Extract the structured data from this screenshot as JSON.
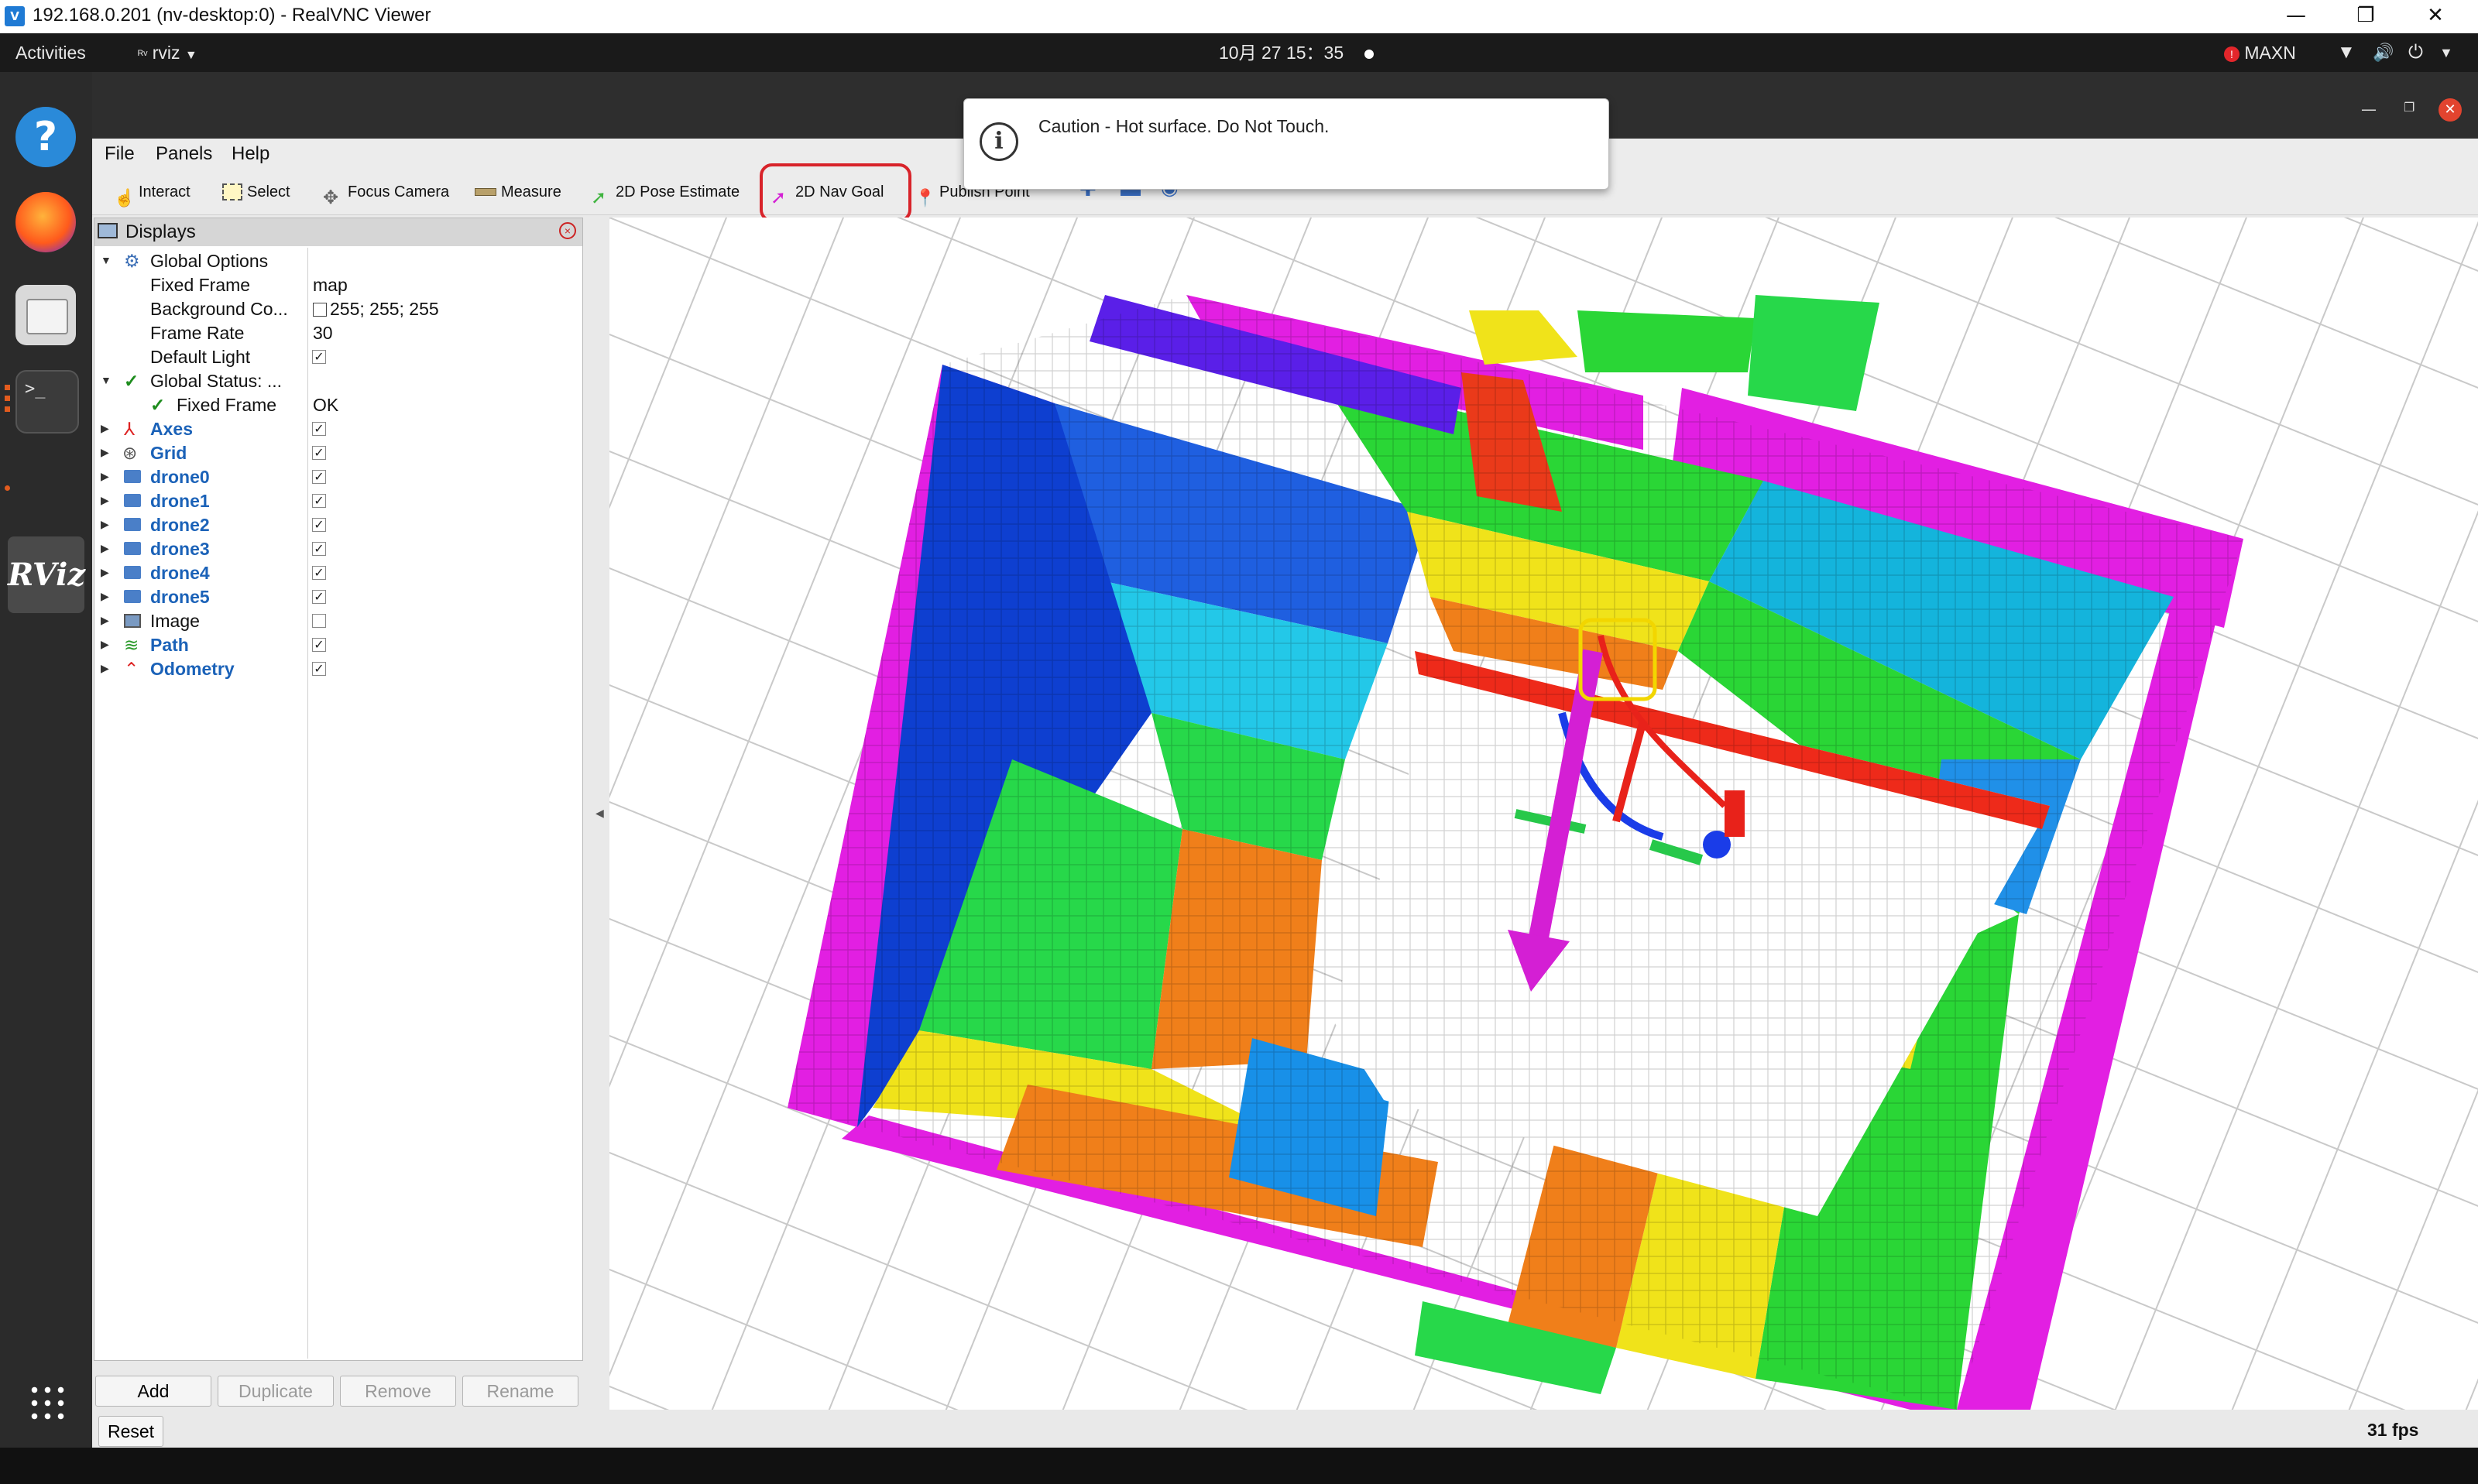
{
  "vnc": {
    "title": "192.168.0.201 (nv-desktop:0) - RealVNC Viewer",
    "minimize_icon": "minimize-icon",
    "restore_icon": "restore-icon",
    "close_icon": "close-icon"
  },
  "topbar": {
    "activities": "Activities",
    "app_name": "rviz",
    "clock": "10月 27  15：35",
    "power_mode": "MAXN"
  },
  "dock": {
    "items": [
      "help-icon",
      "firefox-icon",
      "files-icon",
      "terminal-icon",
      "rviz-icon",
      "app-grid-icon"
    ],
    "rviz_label": "RViz"
  },
  "menu": {
    "file": "File",
    "panels": "Panels",
    "help": "Help"
  },
  "toolbar": {
    "interact": "Interact",
    "select": "Select",
    "focus_camera": "Focus Camera",
    "measure": "Measure",
    "pose_estimate": "2D Pose Estimate",
    "nav_goal": "2D Nav Goal",
    "publish_point": "Publish Point"
  },
  "notification": {
    "text": "Caution - Hot surface. Do Not Touch."
  },
  "displays": {
    "title": "Displays",
    "global_options": {
      "label": "Global Options",
      "fixed_frame_label": "Fixed Frame",
      "fixed_frame_value": "map",
      "background_label": "Background Co...",
      "background_value": "255; 255; 255",
      "frame_rate_label": "Frame Rate",
      "frame_rate_value": "30",
      "default_light_label": "Default Light",
      "default_light_checked": "✓"
    },
    "global_status": {
      "label": "Global Status: ...",
      "fixed_frame_label": "Fixed Frame",
      "fixed_frame_value": "OK"
    },
    "items": [
      {
        "label": "Axes",
        "checked": "✓"
      },
      {
        "label": "Grid",
        "checked": "✓"
      },
      {
        "label": "drone0",
        "checked": "✓"
      },
      {
        "label": "drone1",
        "checked": "✓"
      },
      {
        "label": "drone2",
        "checked": "✓"
      },
      {
        "label": "drone3",
        "checked": "✓"
      },
      {
        "label": "drone4",
        "checked": "✓"
      },
      {
        "label": "drone5",
        "checked": "✓"
      },
      {
        "label": "Image",
        "checked": ""
      },
      {
        "label": "Path",
        "checked": "✓"
      },
      {
        "label": "Odometry",
        "checked": "✓"
      }
    ],
    "buttons": {
      "add": "Add",
      "duplicate": "Duplicate",
      "remove": "Remove",
      "rename": "Rename"
    }
  },
  "status": {
    "reset": "Reset",
    "fps": "31 fps"
  },
  "colors": {
    "wall_magenta": "#e61ee6",
    "highlight_red": "#d8232a",
    "highlight_yellow": "#f2d600"
  }
}
